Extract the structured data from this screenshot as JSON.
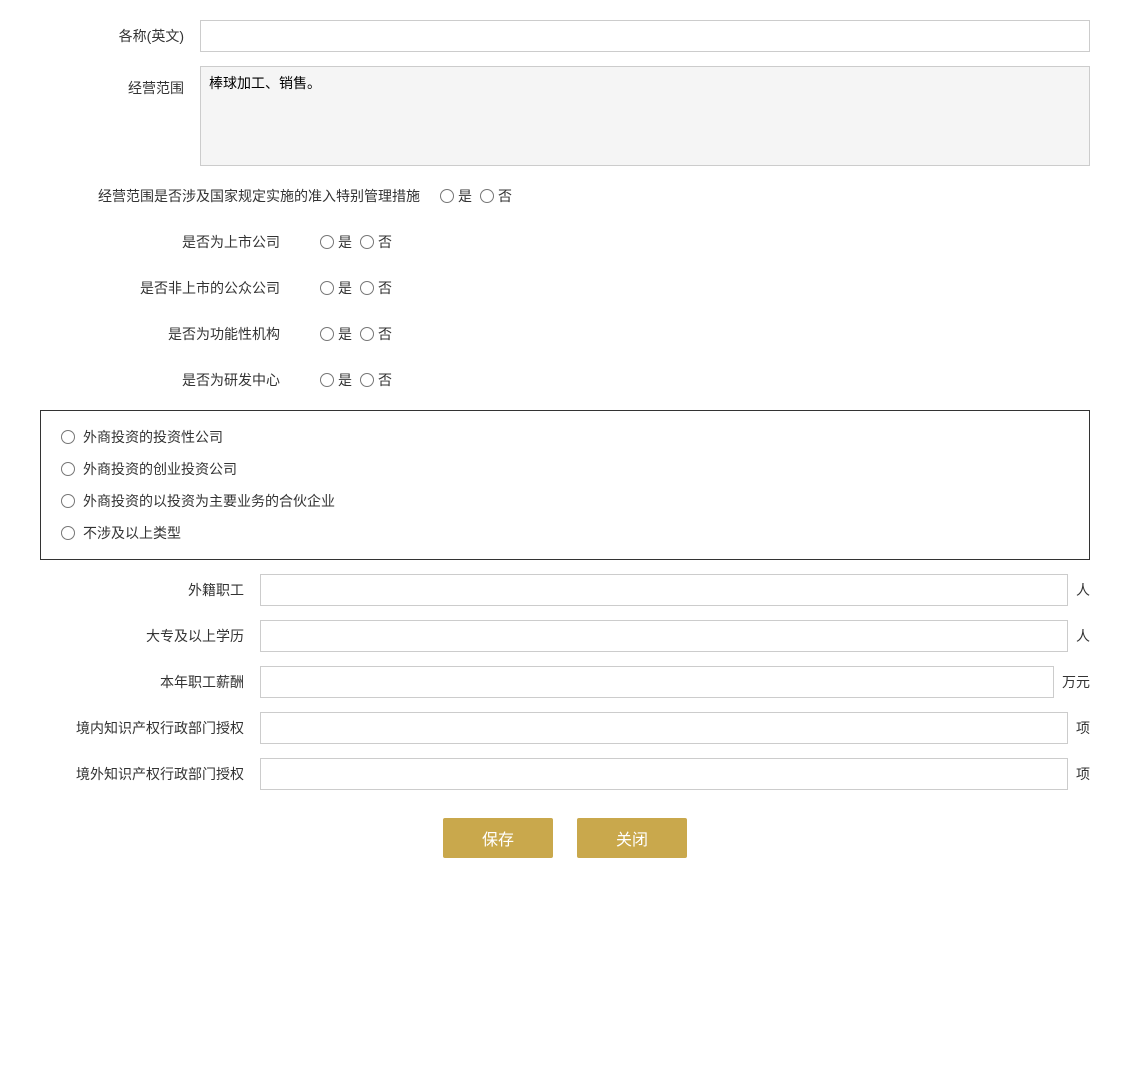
{
  "form": {
    "name_en_label": "各称(英文)",
    "name_en_placeholder": "",
    "business_scope_label": "经营范围",
    "business_scope_value": "棒球加工、销售。",
    "special_management_label": "经营范围是否涉及国家规定实施的准入特别管理措施",
    "special_management_yes": "是",
    "special_management_no": "否",
    "listed_company_label": "是否为上市公司",
    "listed_company_yes": "是",
    "listed_company_no": "否",
    "non_listed_public_label": "是否非上市的公众公司",
    "non_listed_public_yes": "是",
    "non_listed_public_no": "否",
    "functional_institution_label": "是否为功能性机构",
    "functional_institution_yes": "是",
    "functional_institution_no": "否",
    "rd_center_label": "是否为研发中心",
    "rd_center_yes": "是",
    "rd_center_no": "否",
    "investment_company_option": "外商投资的投资性公司",
    "venture_investment_option": "外商投资的创业投资公司",
    "partnership_investment_option": "外商投资的以投资为主要业务的合伙企业",
    "not_applicable_option": "不涉及以上类型",
    "foreign_staff_label": "外籍职工",
    "foreign_staff_unit": "人",
    "college_degree_label": "大专及以上学历",
    "college_degree_unit": "人",
    "annual_salary_label": "本年职工薪酬",
    "annual_salary_unit": "万元",
    "domestic_ip_label": "境内知识产权行政部门授权",
    "domestic_ip_unit": "项",
    "foreign_ip_label": "境外知识产权行政部门授权",
    "foreign_ip_unit": "项",
    "save_button": "保存",
    "close_button": "关闭"
  }
}
